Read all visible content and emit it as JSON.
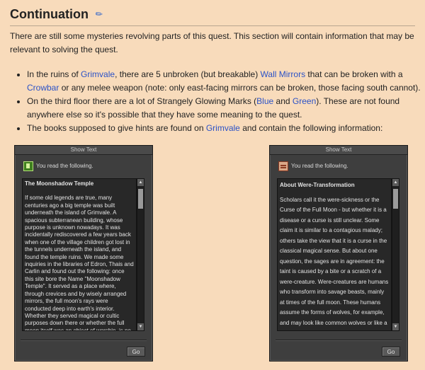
{
  "section": {
    "title": "Continuation",
    "edit_icon": "pencil-icon"
  },
  "intro": "There are still some mysteries revolving parts of this quest. This section will contain information that may be relevant to solving the quest.",
  "bullets": [
    {
      "pre": "In the ruins of ",
      "link1": "Grimvale",
      "mid": ", there are 5 unbroken (but breakable) ",
      "link2": "Wall Mirrors",
      "mid2": " that can be broken with a ",
      "link3": "Crowbar",
      "post": " or any melee weapon (note: only east-facing mirrors can be broken, those facing south cannot)."
    },
    {
      "pre": "On the third floor there are a lot of Strangely Glowing Marks (",
      "link1": "Blue",
      "mid": " and ",
      "link2": "Green",
      "post": "). These are not found anywhere else so it's possible that they have some meaning to the quest."
    },
    {
      "pre": "The books supposed to give hints are found on ",
      "link1": "Grimvale",
      "post": " and contain the following information:"
    }
  ],
  "windows": [
    {
      "title": "Show Text",
      "icon": "green-book-icon",
      "header": "You read the following.",
      "book_title": "The Moonshadow Temple",
      "book_body": "If some old legends are true, many centuries ago a big temple was built underneath the island of Grimvale. A spacious subterranean building, whose purpose is unknown nowadays. It was incidentally rediscovered a few years back when one of the village children got lost in the tunnels underneath the island, and found the temple ruins. We made some inquiries in the libraries of Edron, Thais and Carlin and found out the following: once this site bore the Name \"Moonshadow Temple\". It served as a place where, through crevices and by wisely arranged mirrors, the full moon's rays were conducted deep into earth's interior. Whether they served magical or cultic purposes down there or whether the full moon itself was an object of worship, is no longer known.",
      "button": "Go"
    },
    {
      "title": "Show Text",
      "icon": "red-scroll-icon",
      "header": "You read the following.",
      "book_title": "About Were-Transformation",
      "book_body": "Scholars call it the were-sickness or the Curse of the Full Moon - but whether it is a disease or a curse is still unclear. Some claim it is similar to a contagious malady; others take the view that it is a curse in the classical magical sense. But about one question, the sages are in agreement: the taint is caused by a bite or a scratch of a were-creature. Were-creatures are humans who transform into savage beasts, mainly at times of the full moon. These humans assume the forms of wolves, for example, and may look like common wolves or like a cross between",
      "button": "Go"
    }
  ]
}
